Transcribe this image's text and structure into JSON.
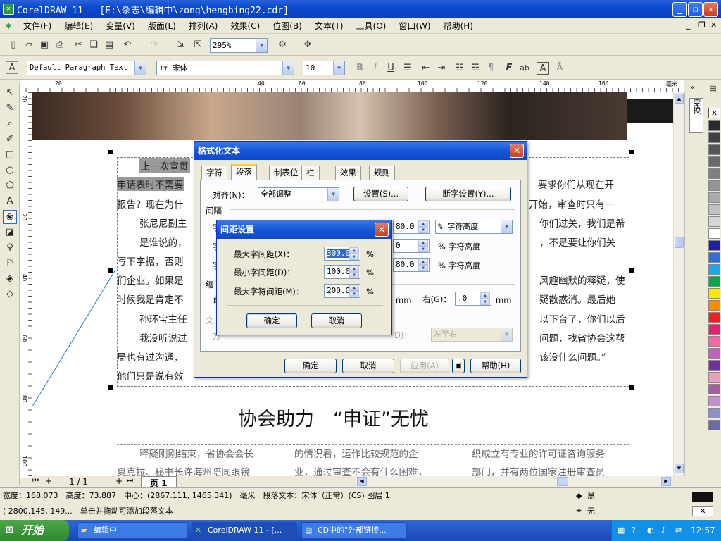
{
  "window": {
    "title": "CorelDRAW 11 - [E:\\杂志\\编辑中\\zong\\hengbing22.cdr]",
    "min": "_",
    "max": "❐",
    "close": "✕"
  },
  "menu": [
    "文件(F)",
    "编辑(E)",
    "变量(V)",
    "版面(L)",
    "排列(A)",
    "效果(C)",
    "位图(B)",
    "文本(T)",
    "工具(O)",
    "窗口(W)",
    "帮助(H)"
  ],
  "toolbar1": {
    "zoom": "295%"
  },
  "toolbar2": {
    "para_style": "Default Paragraph Text",
    "font": "宋体",
    "size": "10",
    "font_icon": "Tт"
  },
  "ruler": {
    "unit": "毫米",
    "h_ticks": [
      "20",
      "",
      "20",
      "40",
      "60",
      "80",
      "100",
      "120",
      "140",
      "160"
    ],
    "v_ticks": [
      "20",
      "0",
      "20",
      "40",
      "60",
      "80",
      "100"
    ]
  },
  "document": {
    "lines": [
      "上一次宣贯",
      "申请表时不需要",
      "报告？现在为什",
      "张尼尼副主",
      "是谁说的，",
      "写下字据，否则",
      "们企业。如果是",
      "时候我是肯定不",
      "孙环宝主任",
      "我没听说过",
      "局也有过沟通，",
      "他们只是说有效"
    ],
    "right_lines": [
      "要求你们从现在开",
      "开始，审查时只有一",
      "你们过关，我们是希",
      "，不是要让你们关",
      "",
      "风趣幽默的释疑，使",
      "疑散惑消。最后她",
      "以下台了，你们以后",
      "问题，找省协会这帮",
      "该没什么问题。”"
    ],
    "headline": "协会助力　“申证”无忧",
    "col_text": [
      [
        "释疑刚刚结束，省协会会长",
        "夏克拉、秘书长许海州陪同眼镜"
      ],
      [
        "的情况看，运作比较规范的企",
        "业，通过审查不会有什么困难，"
      ],
      [
        "织成立有专业的许可证咨询服务",
        "部门，并有两位国家注册审查员"
      ]
    ]
  },
  "format_dialog": {
    "title": "格式化文本",
    "tabs": [
      "字符",
      "段落",
      "制表位",
      "栏",
      "效果",
      "规则"
    ],
    "align_label": "对齐(N)：",
    "align_value": "全部调整",
    "settings_btn": "设置(S)...",
    "hyphen_btn": "断字设置(Y)...",
    "spacing_label": "间隔",
    "row_vals": [
      "80.0",
      "0",
      "80.0"
    ],
    "unit_combo": "% 字符高度",
    "unit_text": "% 字符高度",
    "mm": "mm",
    "right_label": "右(G)：",
    "right_val": ".0",
    "dir_value": "左至右",
    "ok": "确定",
    "cancel": "取消",
    "apply": "应用(A)",
    "help": "帮助(H)",
    "partial": [
      "字",
      "字",
      "字",
      "缩",
      "首",
      "文",
      "方",
      "D)："
    ]
  },
  "spacing_dialog": {
    "title": "间距设置",
    "max_char_label": "最大字间距(X)：",
    "max_char": "300.0",
    "min_char_label": "最小字间距(D)：",
    "min_char": "100.0",
    "max_word_label": "最大字符间距(M)：",
    "max_word": "200.0",
    "pct": "%",
    "ok": "确定",
    "cancel": "取消"
  },
  "pagebar": {
    "pages": "1 / 1",
    "page_tab": "页 1"
  },
  "status": {
    "line1": "宽度：168.073　高度：73.887　中心：(2867.111, 1465.341)　毫米　段落文本：宋体（正常）(CS) 图层 1",
    "line2": "( 2800.145, 149...　单击并拖动可添加段落文本",
    "fill": "黑",
    "outline": "无"
  },
  "docker": {
    "label": "变换"
  },
  "palette": [
    "#2b2b2b",
    "#404040",
    "#555555",
    "#6a6a6a",
    "#808080",
    "#959595",
    "#aaaaaa",
    "#c0c0c0",
    "#d5d5d5",
    "#ffffff",
    "#2020a0",
    "#2f6fd6",
    "#1aa9e6",
    "#0aa84a",
    "#ffe600",
    "#ff8a00",
    "#f02020",
    "#e8206e",
    "#f06aa8",
    "#c060c0",
    "#7030a0",
    "#e8a0c0",
    "#a060a0",
    "#c090d0",
    "#9090c8",
    "#6a6aa8"
  ],
  "taskbar": {
    "start": "开始",
    "tasks": [
      "编辑中",
      "CorelDRAW 11 - [...",
      "CD中的\"外部链接..."
    ],
    "clock": "12:57"
  }
}
